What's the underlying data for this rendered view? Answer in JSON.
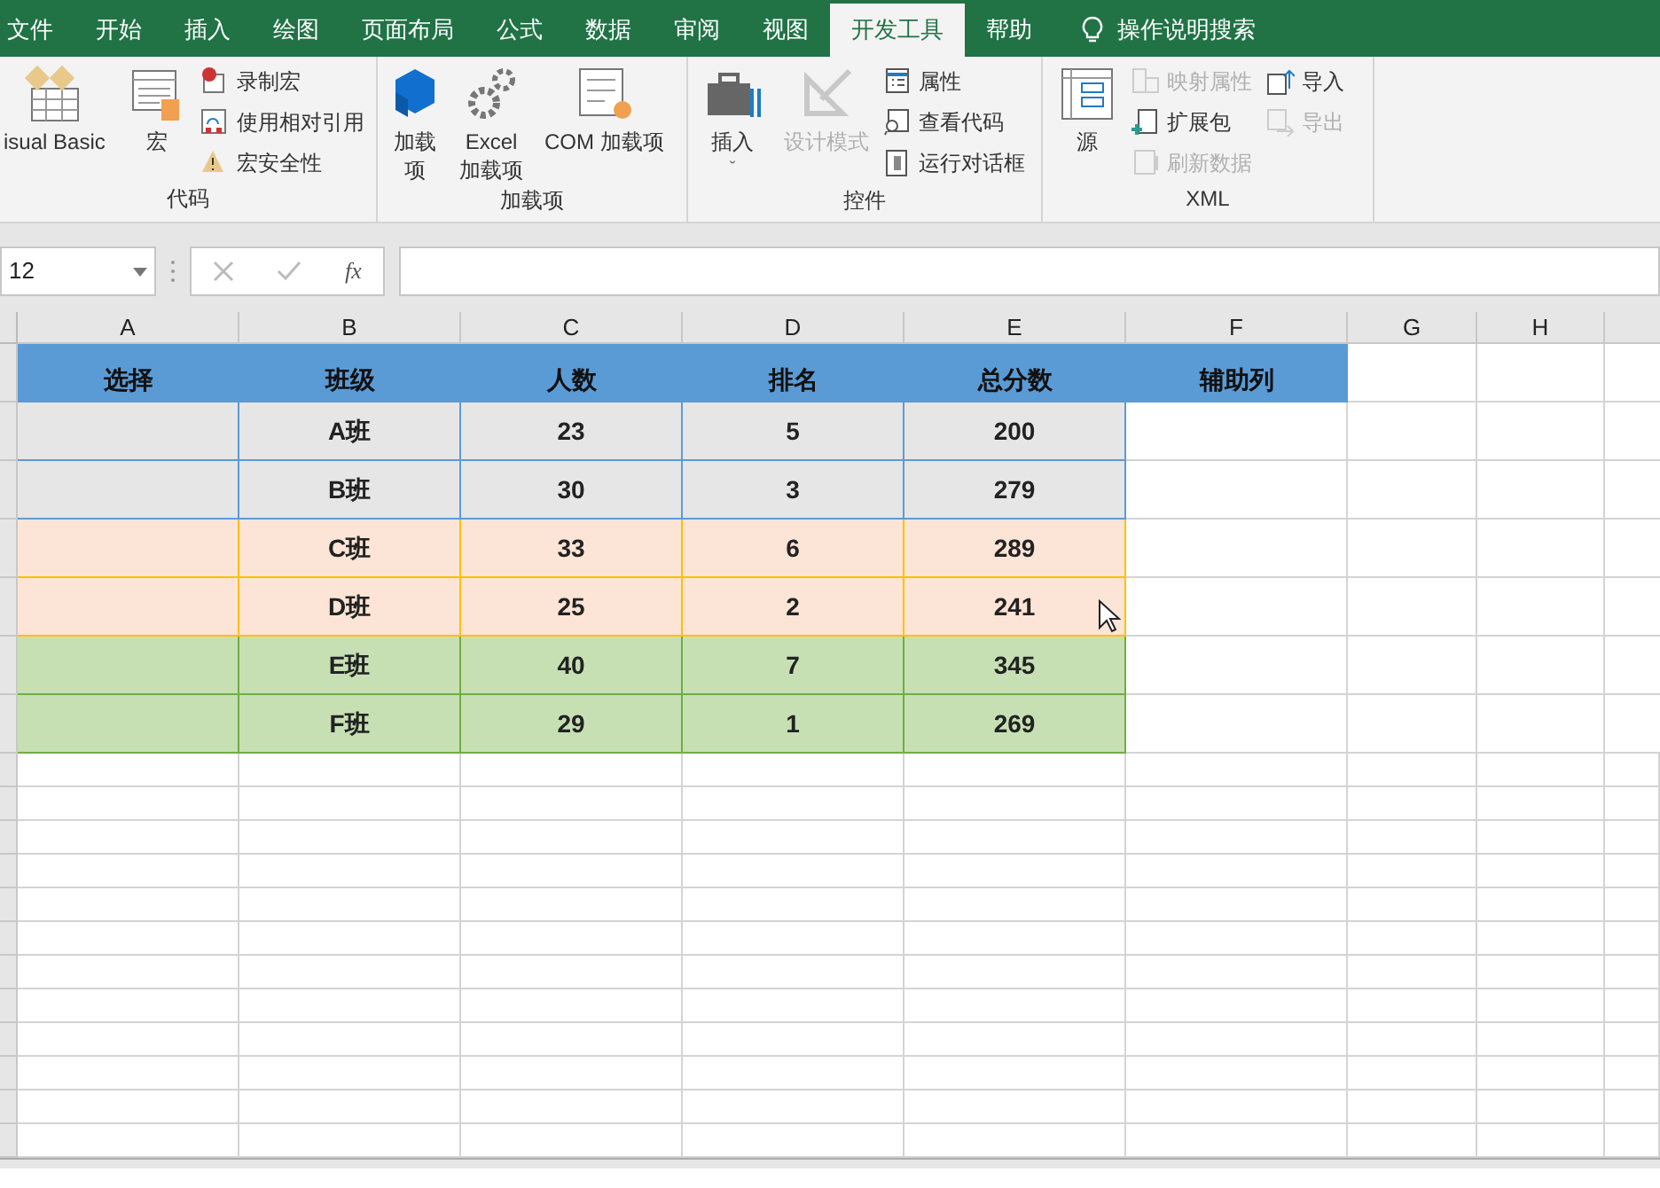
{
  "tabs": [
    {
      "label": "文件",
      "selected": false
    },
    {
      "label": "开始",
      "selected": false
    },
    {
      "label": "插入",
      "selected": false
    },
    {
      "label": "绘图",
      "selected": false
    },
    {
      "label": "页面布局",
      "selected": false
    },
    {
      "label": "公式",
      "selected": false
    },
    {
      "label": "数据",
      "selected": false
    },
    {
      "label": "审阅",
      "selected": false
    },
    {
      "label": "视图",
      "selected": false
    },
    {
      "label": "开发工具",
      "selected": true
    },
    {
      "label": "帮助",
      "selected": false
    }
  ],
  "tell_me": "操作说明搜索",
  "ribbon_groups": [
    {
      "label": "代码",
      "large": [
        {
          "label": "isual Basic"
        },
        {
          "label": "宏"
        }
      ],
      "small": [
        {
          "label": "录制宏"
        },
        {
          "label": "使用相对引用"
        },
        {
          "label": "宏安全性"
        }
      ]
    },
    {
      "label": "加载项",
      "large": [
        {
          "label": "加载项"
        },
        {
          "label": "Excel\n加载项"
        },
        {
          "label": "COM 加载项"
        }
      ]
    },
    {
      "label": "控件",
      "large": [
        {
          "label": "插入",
          "dropdown": "ˇ",
          "disabled": false
        },
        {
          "label": "设计模式",
          "disabled": true
        }
      ],
      "small": [
        {
          "label": "属性"
        },
        {
          "label": "查看代码"
        },
        {
          "label": "运行对话框"
        }
      ]
    },
    {
      "label": "XML",
      "large": [
        {
          "label": "源"
        }
      ],
      "small": [
        {
          "label": "映射属性",
          "disabled": true
        },
        {
          "label": "扩展包",
          "disabled": false
        },
        {
          "label": "刷新数据",
          "disabled": true
        },
        {
          "label": "导入",
          "disabled": false
        },
        {
          "label": "导出",
          "disabled": true
        }
      ]
    }
  ],
  "name_box": "12",
  "fx": "fx",
  "columns": [
    "A",
    "B",
    "C",
    "D",
    "E",
    "F",
    "G",
    "H"
  ],
  "table": {
    "header": [
      "选择",
      "班级",
      "人数",
      "排名",
      "总分数",
      "辅助列"
    ],
    "rows": [
      {
        "color": "#e7e6e6",
        "cells": [
          "",
          "A班",
          "23",
          "5",
          "200"
        ]
      },
      {
        "color": "#e7e6e6",
        "cells": [
          "",
          "B班",
          "30",
          "3",
          "279"
        ]
      },
      {
        "color": "#fce4d6",
        "cells": [
          "",
          "C班",
          "33",
          "6",
          "289"
        ]
      },
      {
        "color": "#fce4d6",
        "cells": [
          "",
          "D班",
          "25",
          "2",
          "241"
        ]
      },
      {
        "color": "#c6e0b4",
        "cells": [
          "",
          "E班",
          "40",
          "7",
          "345"
        ]
      },
      {
        "color": "#c6e0b4",
        "cells": [
          "",
          "F班",
          "29",
          "1",
          "269"
        ]
      }
    ]
  }
}
